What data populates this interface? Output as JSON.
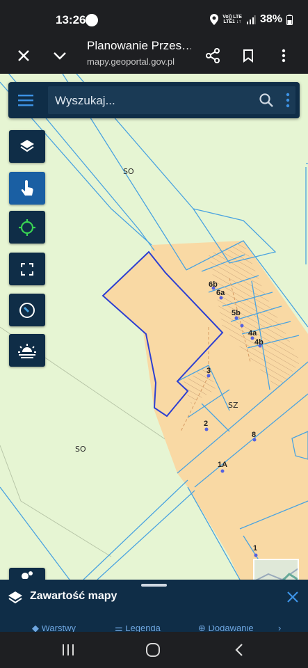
{
  "status_bar": {
    "time": "13:26",
    "battery": "38%",
    "network_top": "Vo)) LTE",
    "network_bottom": "LTE1 ↓↑"
  },
  "browser": {
    "page_title": "Planowanie Przes…",
    "url": "mapy.geoportal.gov.pl"
  },
  "search": {
    "placeholder": "Wyszukaj..."
  },
  "map": {
    "zone_labels": [
      "SO",
      "SO",
      "SZ"
    ],
    "plot_labels": [
      "6b",
      "6a",
      "5b",
      "4a",
      "4b",
      "3",
      "2",
      "8",
      "1A",
      "1"
    ],
    "colors": {
      "background": "#e6f5d3",
      "parcel_fill": "#f9d9a4",
      "parcel_line": "#4aa3e0",
      "selected_outline": "#2d3fd1",
      "hatch": "#c9a27a"
    }
  },
  "bottom_panel": {
    "title": "Zawartość mapy",
    "tabs": [
      "Warstwy",
      "Legenda",
      "Dodawanie"
    ]
  }
}
